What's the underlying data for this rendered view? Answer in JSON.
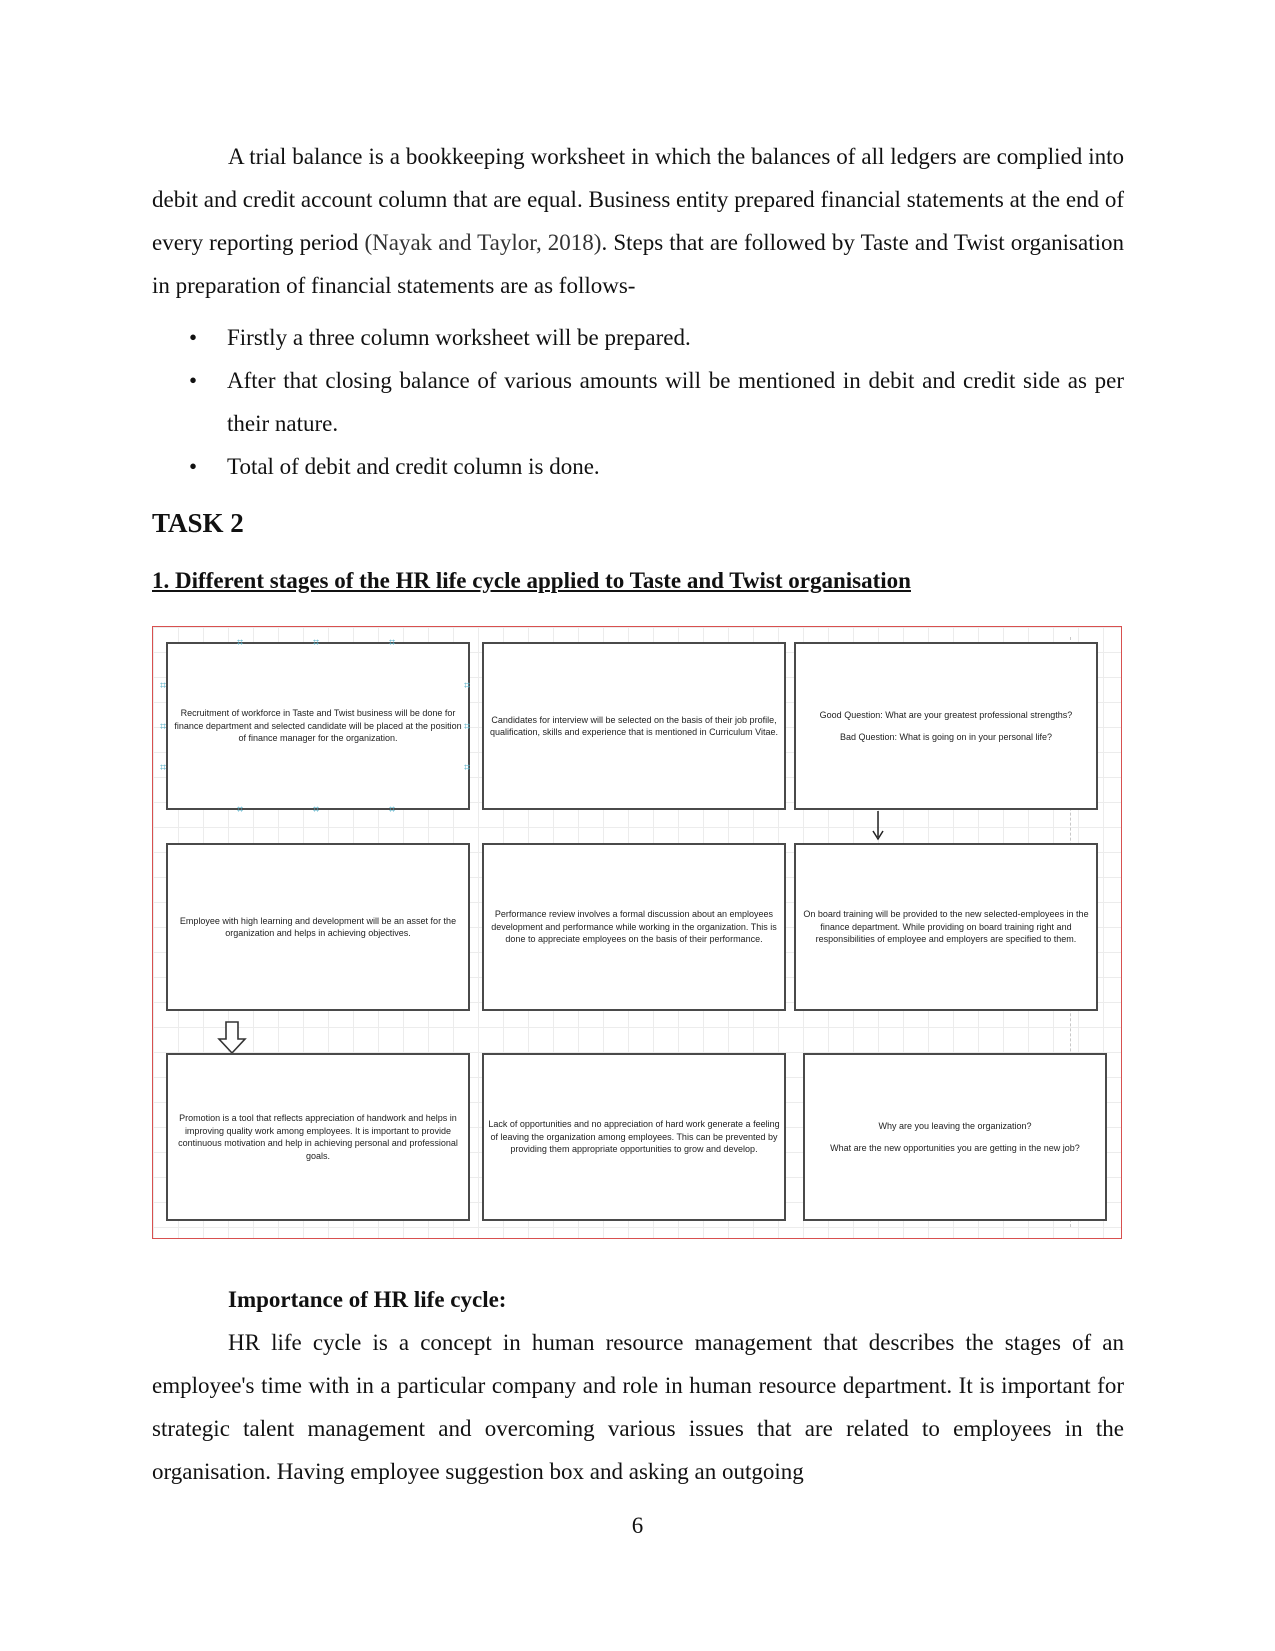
{
  "document": {
    "intro_paragraph": {
      "before_citation": "A trial balance is a bookkeeping worksheet in which the balances of all ledgers are complied into debit and credit account column that are equal. Business entity prepared financial statements at the end of every reporting period ",
      "citation": "(Nayak and Taylor, 2018)",
      "after_citation": ". Steps that are followed by Taste and Twist organisation in preparation of financial statements are as follows-"
    },
    "bullets": [
      "Firstly a three column worksheet will be prepared.",
      "After that closing balance of various amounts will be mentioned in debit and credit side as per their nature.",
      "Total of debit and credit column is done."
    ],
    "bullet_glyph": "•",
    "task_title": "TASK 2",
    "section_heading": "1.  Different stages of the HR life cycle applied to Taste and Twist organisation",
    "diagram": {
      "boxes": [
        [
          "Recruitment of workforce in Taste and Twist business will be done for finance department and selected candidate will be placed at the position of finance manager for the organization."
        ],
        [
          "Candidates for interview will be selected on the basis of their job profile, qualification, skills and experience that is mentioned in Curriculum Vitae."
        ],
        [
          "Good Question: What are your greatest professional strengths?",
          "Bad Question: What is going on in your personal life?"
        ],
        [
          "Employee with high learning and development will be an asset for the organization and helps in achieving objectives."
        ],
        [
          "Performance review involves a formal discussion about an employees development and performance while working in the organization. This is done to appreciate employees on the basis of their performance."
        ],
        [
          "On board training will be provided to the new selected-employees in the finance department. While providing on board training right and responsibilities of employee and employers are specified to them."
        ],
        [
          "Promotion is a tool that reflects appreciation of handwork and helps in improving quality work among employees. It is important to provide continuous motivation and help in achieving personal and professional goals."
        ],
        [
          "Lack of opportunities and no appreciation of hard work generate a feeling of leaving the organization among employees. This can be prevented by providing them appropriate opportunities to grow and develop."
        ],
        [
          "Why are you leaving the organization?",
          "What are the new opportunities you are getting in the new job?"
        ]
      ],
      "selection_handle_glyph": "⌗",
      "colors": {
        "frame": "#d8504f",
        "box_border": "#4a4a4a",
        "handle": "#5ab2c9",
        "grid": "#ececec"
      }
    },
    "importance_heading": "Importance of HR life cycle:",
    "importance_paragraph": "HR life cycle is a concept in human resource management that describes the stages of an employee's time with in a particular company and role in human resource department. It is important for strategic talent management and overcoming various issues that are related to employees in the organisation. Having employee suggestion box and asking an outgoing",
    "page_number": "6"
  }
}
